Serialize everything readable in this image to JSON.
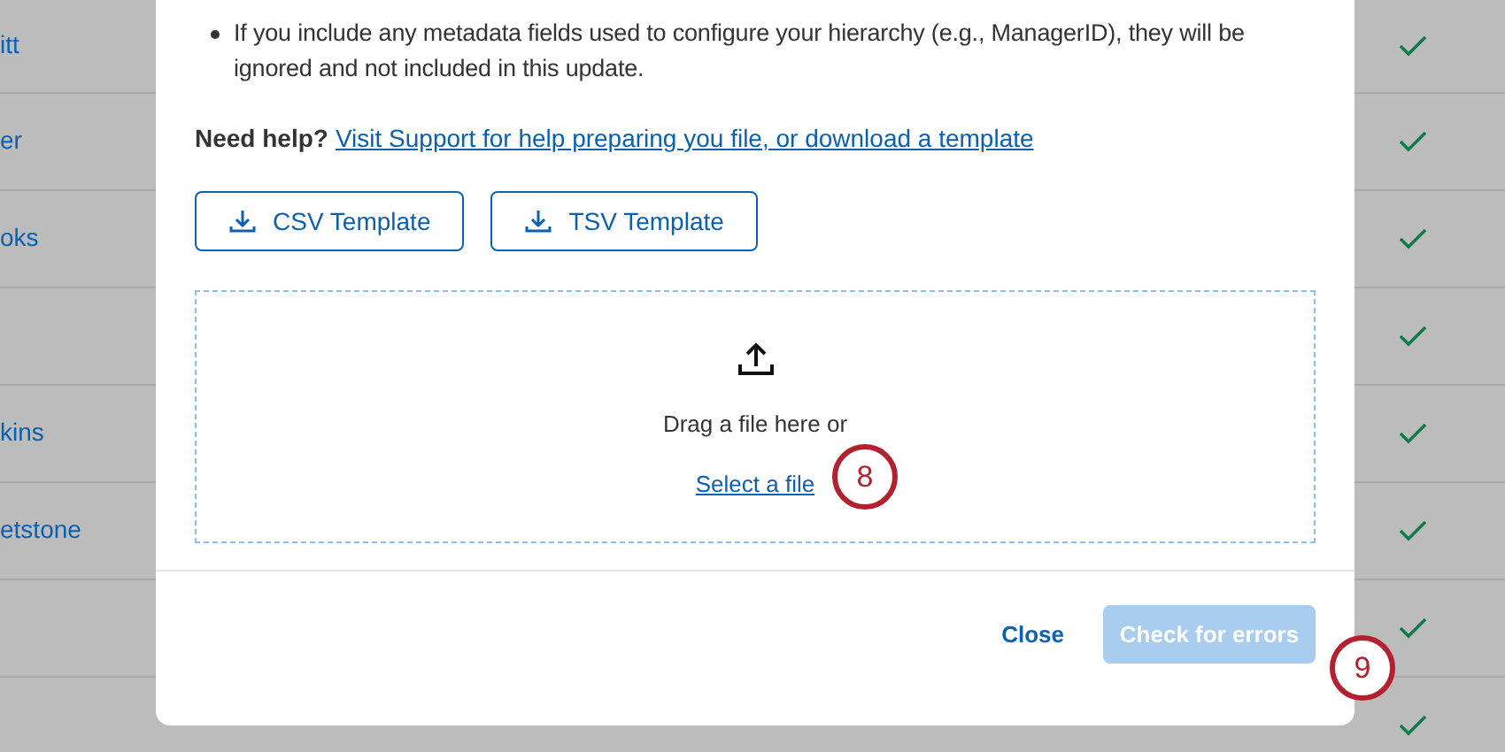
{
  "background_table": {
    "rows": [
      {
        "name": "itt",
        "complete": true
      },
      {
        "name": "er",
        "complete": true
      },
      {
        "name": "oks",
        "complete": true
      },
      {
        "complete": true
      },
      {
        "name": "kins",
        "complete": true
      },
      {
        "name": "etstone",
        "complete": true
      },
      {
        "complete": true
      },
      {
        "complete": true
      }
    ]
  },
  "dialog": {
    "bullets": [
      {
        "text": "If you include any metadata fields used to configure your hierarchy (e.g., ManagerID), they will be ignored and not included in this update."
      }
    ],
    "help": {
      "label": "Need help?",
      "link": "Visit Support for help preparing you file, or download a template"
    },
    "template_buttons": [
      "CSV Template",
      "TSV Template"
    ],
    "dropzone": {
      "prompt": "Drag a file here or",
      "link": "Select a file",
      "step": "8"
    },
    "footer": {
      "close": "Close",
      "submit": {
        "label": "Check for errors",
        "disabled": true
      },
      "step": "9"
    }
  }
}
